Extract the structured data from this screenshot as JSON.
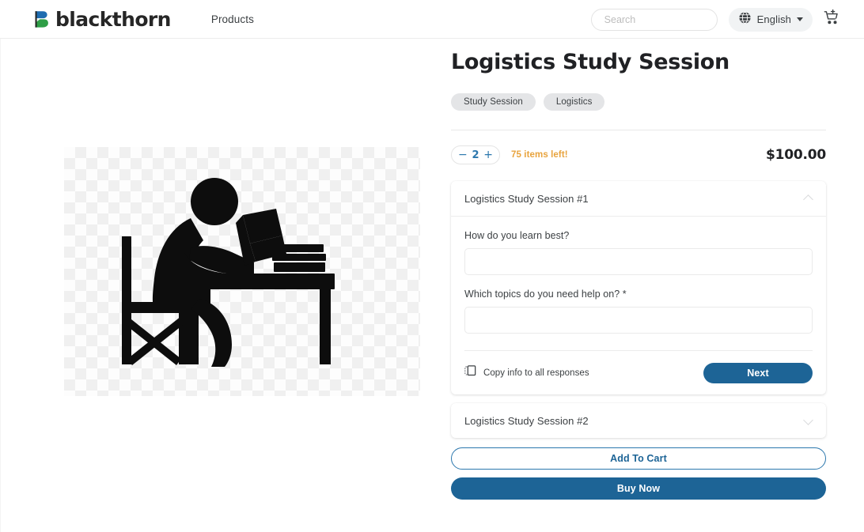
{
  "header": {
    "brand_name": "blackthorn",
    "brand_colors": {
      "blue": "#1f6cb0",
      "green": "#2e9e46",
      "wordmark": "#262626"
    },
    "nav": {
      "products_label": "Products"
    },
    "search": {
      "placeholder": "Search",
      "value": ""
    },
    "language": {
      "selected": "English"
    },
    "icons": {
      "search": "search-icon",
      "globe": "globe-icon",
      "cart": "add-shopping-cart-icon"
    }
  },
  "product": {
    "title": "Logistics Study Session",
    "tags": [
      "Study Session",
      "Logistics"
    ],
    "image_alt": "person-studying-at-desk-silhouette",
    "quantity": {
      "value": "2",
      "decrement_label": "−",
      "increment_label": "+",
      "items_left": "75 items left!",
      "items_left_color": "#e8a33d"
    },
    "price": "$100.00"
  },
  "sessions": [
    {
      "title": "Logistics Study Session #1",
      "expanded": true,
      "fields": [
        {
          "label": "How do you learn best?",
          "value": "",
          "required": false
        },
        {
          "label": "Which topics do you need help on? *",
          "value": "",
          "required": true
        }
      ],
      "copy_label": "Copy info to all responses",
      "next_label": "Next"
    },
    {
      "title": "Logistics Study Session #2",
      "expanded": false,
      "fields": [],
      "copy_label": "",
      "next_label": ""
    }
  ],
  "actions": {
    "add_to_cart_label": "Add To Cart",
    "buy_now_label": "Buy Now",
    "primary_color": "#1d6496",
    "outline_color": "#2b77ad"
  }
}
